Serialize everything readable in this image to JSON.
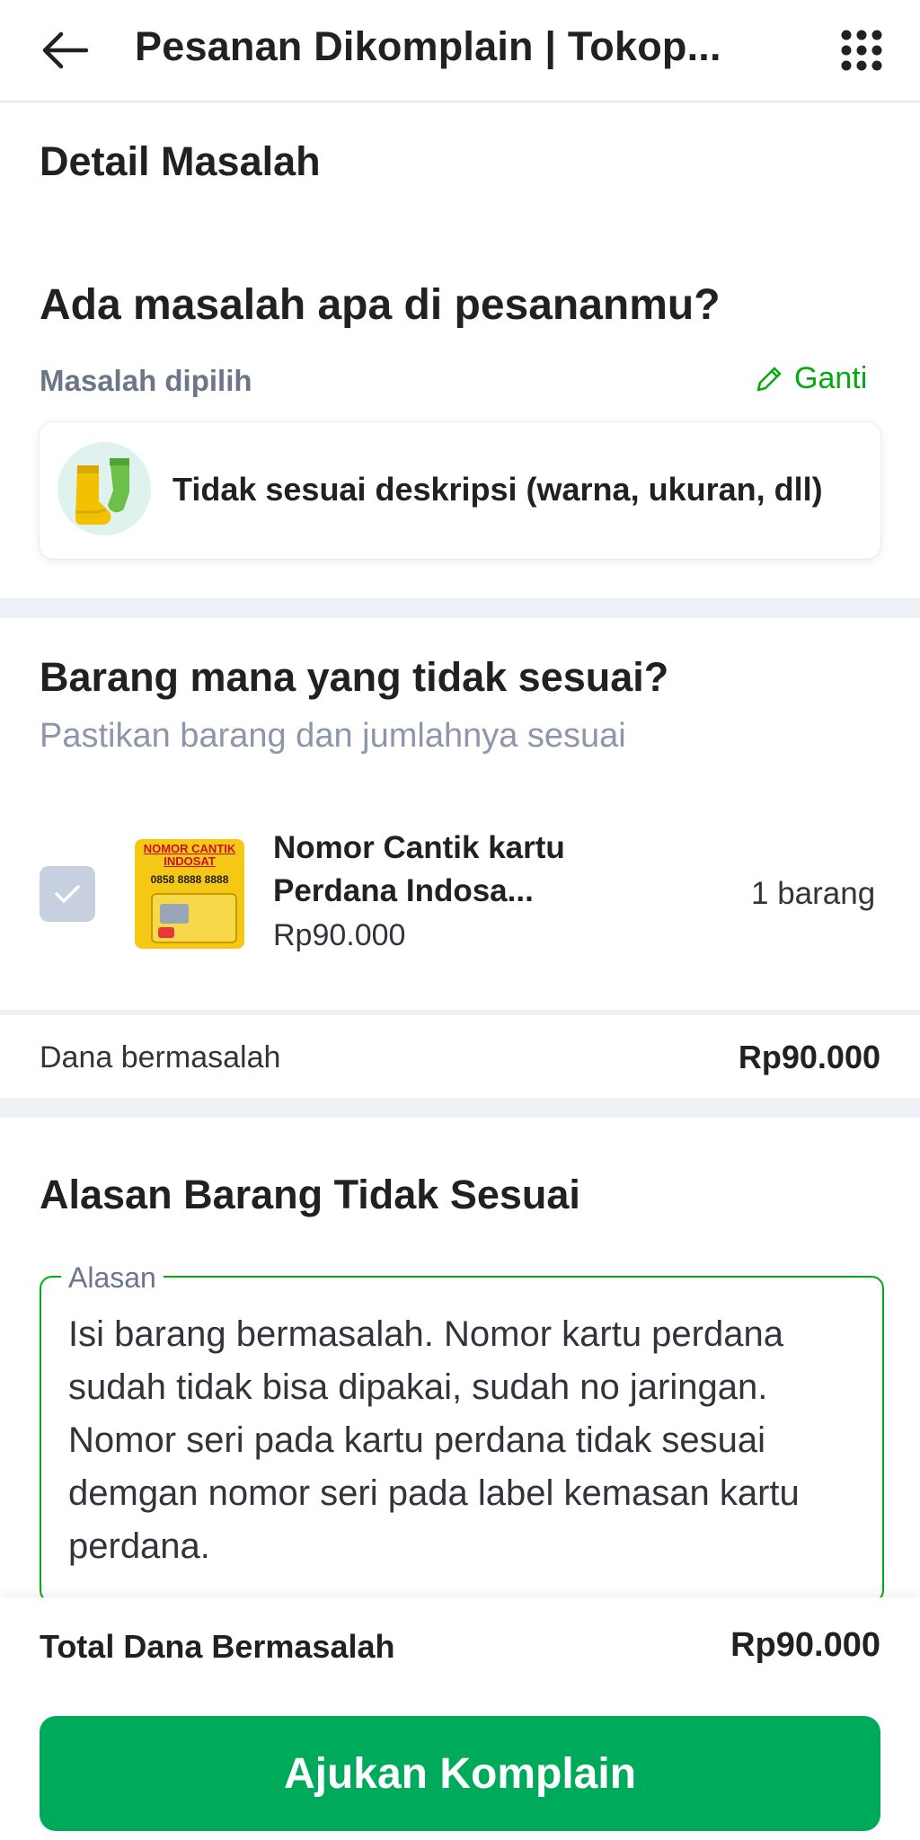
{
  "header": {
    "title": "Pesanan Dikomplain | Tokop...",
    "back_icon": "arrow-left-icon",
    "menu_icon": "grid-menu-icon"
  },
  "detail": {
    "title": "Detail Masalah",
    "question": "Ada masalah apa di pesananmu?",
    "selected_label": "Masalah dipilih",
    "change_label": "Ganti",
    "change_icon": "pencil-icon",
    "problem_text": "Tidak sesuai deskripsi (warna, ukuran, dll)",
    "problem_icon": "socks-icon"
  },
  "items": {
    "title": "Barang mana yang tidak sesuai?",
    "subtitle": "Pastikan barang dan jumlahnya sesuai",
    "product": {
      "name": "Nomor Cantik kartu Perdana Indosa...",
      "price": "Rp90.000",
      "quantity": "1 barang",
      "checked": true,
      "image_texts": [
        "NOMOR CANTIK",
        "INDOSAT",
        "0858 8888 8888"
      ]
    },
    "fund_label": "Dana bermasalah",
    "fund_value": "Rp90.000"
  },
  "reason": {
    "title": "Alasan Barang Tidak Sesuai",
    "field_label": "Alasan",
    "field_value": "Isi barang bermasalah. Nomor kartu perdana sudah tidak bisa dipakai, sudah no jaringan. Nomor seri pada kartu perdana tidak sesuai demgan nomor seri pada label kemasan kartu perdana."
  },
  "footer": {
    "total_label": "Total Dana Bermasalah",
    "total_value": "Rp90.000",
    "submit_label": "Ajukan Komplain"
  },
  "colors": {
    "accent_green": "#03ac0e",
    "button_green": "#00aa5b",
    "divider": "#eef1f5",
    "muted_text": "#6d7588"
  }
}
